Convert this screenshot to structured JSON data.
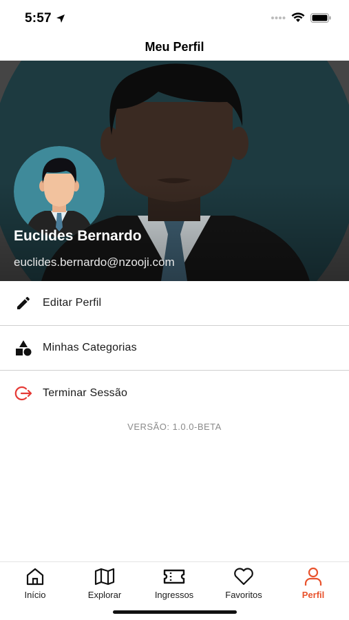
{
  "status": {
    "time": "5:57"
  },
  "nav": {
    "title": "Meu Perfil"
  },
  "profile": {
    "name": "Euclides Bernardo",
    "email": "euclides.bernardo@nzooji.com"
  },
  "menu": [
    {
      "label": "Editar Perfil",
      "icon": "pencil-icon"
    },
    {
      "label": "Minhas Categorias",
      "icon": "shapes-icon"
    },
    {
      "label": "Terminar Sessão",
      "icon": "logout-icon"
    }
  ],
  "version": "VERSÃO: 1.0.0-BETA",
  "tabs": [
    {
      "label": "Início",
      "icon": "home-icon"
    },
    {
      "label": "Explorar",
      "icon": "map-icon"
    },
    {
      "label": "Ingressos",
      "icon": "ticket-icon"
    },
    {
      "label": "Favoritos",
      "icon": "heart-icon"
    },
    {
      "label": "Perfil",
      "icon": "user-icon",
      "active": true
    }
  ],
  "colors": {
    "accent": "#e8522c",
    "logout": "#e53935",
    "hero_bg": "#1d3a40"
  }
}
